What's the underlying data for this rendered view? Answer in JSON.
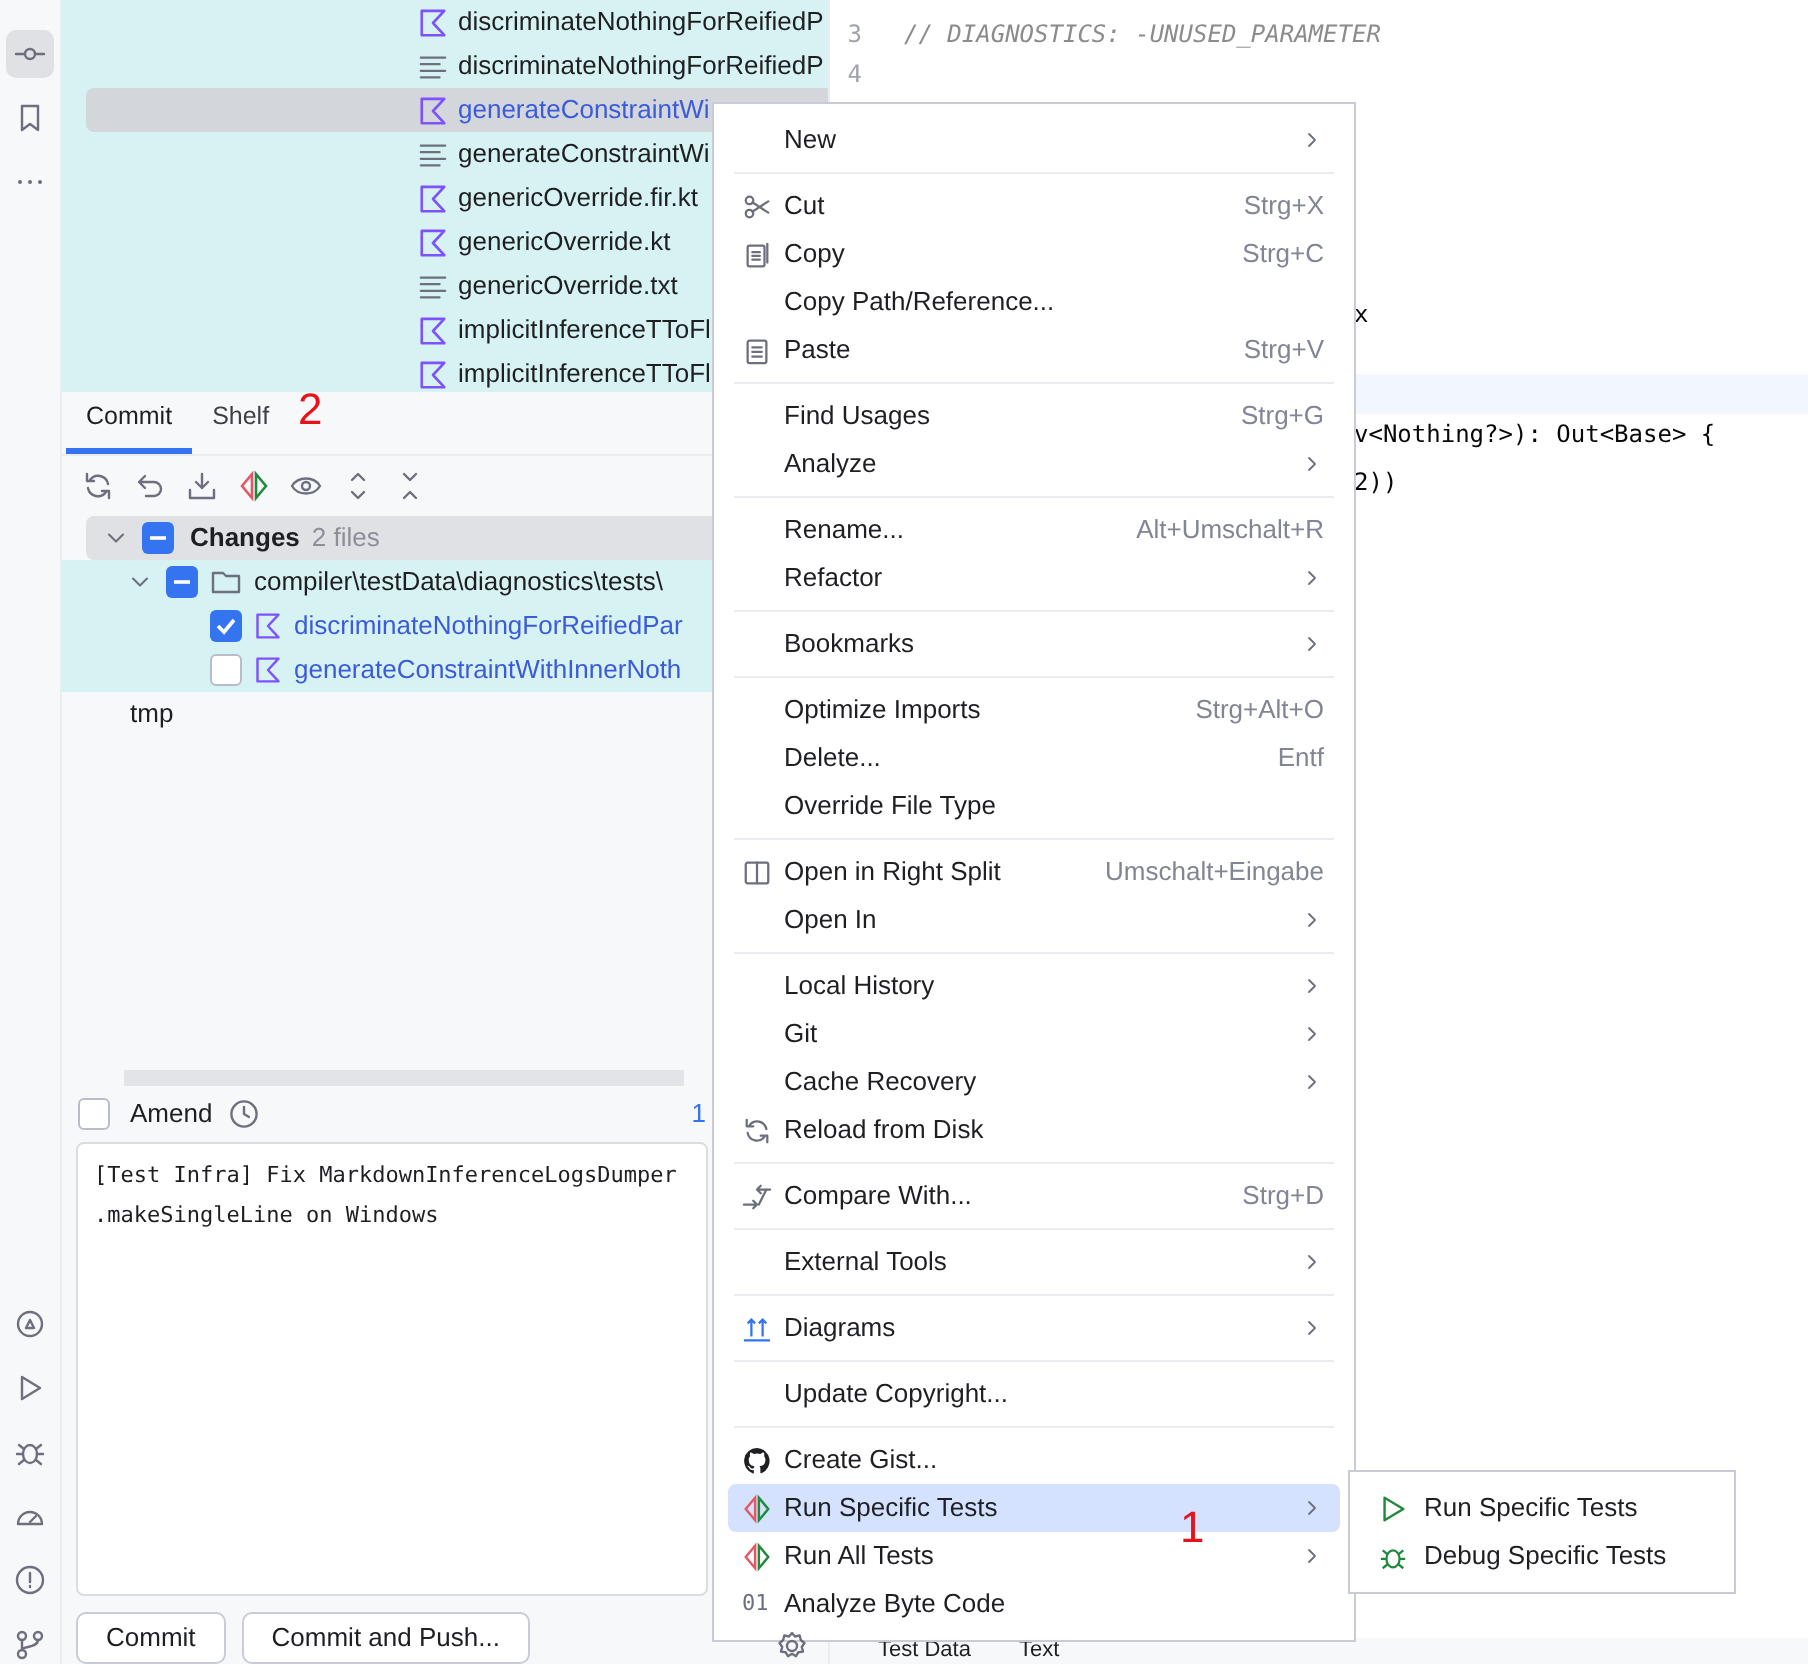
{
  "tool_strip": {
    "top": [
      {
        "selected": true
      },
      {
        "selected": false
      },
      {
        "selected": false
      }
    ]
  },
  "project_tree": {
    "rows": [
      {
        "label": "discriminateNothingForReifiedP",
        "kind": "kotlin",
        "selected": false,
        "modified": false
      },
      {
        "label": "discriminateNothingForReifiedP",
        "kind": "text",
        "selected": false,
        "modified": false
      },
      {
        "label": "generateConstraintWi",
        "kind": "kotlin",
        "selected": true,
        "modified": true
      },
      {
        "label": "generateConstraintWi",
        "kind": "text",
        "selected": false,
        "modified": false
      },
      {
        "label": "genericOverride.fir.kt",
        "kind": "kotlin",
        "selected": false,
        "modified": false
      },
      {
        "label": "genericOverride.kt",
        "kind": "kotlin",
        "selected": false,
        "modified": false
      },
      {
        "label": "genericOverride.txt",
        "kind": "text",
        "selected": false,
        "modified": false
      },
      {
        "label": "implicitInferenceTToFl",
        "kind": "kotlin",
        "selected": false,
        "modified": false
      },
      {
        "label": "implicitInferenceTToFl",
        "kind": "kotlin",
        "selected": false,
        "modified": false
      }
    ]
  },
  "commit_tabs": [
    {
      "label": "Commit",
      "selected": true
    },
    {
      "label": "Shelf",
      "selected": false
    }
  ],
  "annotations": [
    {
      "text": "2"
    },
    {
      "text": "1"
    }
  ],
  "changes": {
    "label": "Changes",
    "count": "2 files",
    "partial": true,
    "folder": {
      "path": "compiler\\testData\\diagnostics\\tests\\",
      "partial": true
    },
    "files": [
      {
        "label": "discriminateNothingForReifiedPar",
        "checked": true
      },
      {
        "label": "generateConstraintWithInnerNoth",
        "checked": false
      }
    ]
  },
  "unversioned": {
    "label": "tmp"
  },
  "amend": {
    "label": "Amend",
    "checked": false,
    "counter": "1"
  },
  "commit_message": {
    "value": "[Test Infra] Fix MarkdownInferenceLogsDumper\n.makeSingleLine on Windows"
  },
  "commit_buttons": [
    "Commit",
    "Commit and Push..."
  ],
  "editor": {
    "lines": [
      {
        "number": "3",
        "text": "// DIAGNOSTICS: -UNUSED_PARAMETER",
        "kind": "comment"
      },
      {
        "number": "4"
      }
    ],
    "fragments": [
      {
        "text": "x"
      },
      {
        "text": "v<Nothing?>): Out<Base> {"
      },
      {
        "text": "2))"
      }
    ],
    "bottom_tabs": [
      "Test Data",
      "Text"
    ]
  },
  "context_menu": {
    "items": [
      {
        "kind": "plain",
        "label": "New",
        "has_submenu": true,
        "selected": false
      },
      {
        "kind": "separator"
      },
      {
        "kind": "cut",
        "label": "Cut",
        "shortcut": "Strg+X",
        "has_submenu": false,
        "selected": false
      },
      {
        "kind": "copy",
        "label": "Copy",
        "shortcut": "Strg+C",
        "has_submenu": false,
        "selected": false
      },
      {
        "kind": "plain",
        "label": "Copy Path/Reference...",
        "has_submenu": false,
        "selected": false
      },
      {
        "kind": "paste",
        "label": "Paste",
        "shortcut": "Strg+V",
        "has_submenu": false,
        "selected": false
      },
      {
        "kind": "separator"
      },
      {
        "kind": "plain",
        "label": "Find Usages",
        "shortcut": "Strg+G",
        "has_submenu": false,
        "selected": false
      },
      {
        "kind": "plain",
        "label": "Analyze",
        "has_submenu": true,
        "selected": false
      },
      {
        "kind": "separator"
      },
      {
        "kind": "plain",
        "label": "Rename...",
        "shortcut": "Alt+Umschalt+R",
        "has_submenu": false,
        "selected": false
      },
      {
        "kind": "plain",
        "label": "Refactor",
        "has_submenu": true,
        "selected": false
      },
      {
        "kind": "separator"
      },
      {
        "kind": "plain",
        "label": "Bookmarks",
        "has_submenu": true,
        "selected": false
      },
      {
        "kind": "separator"
      },
      {
        "kind": "plain",
        "label": "Optimize Imports",
        "shortcut": "Strg+Alt+O",
        "has_submenu": false,
        "selected": false
      },
      {
        "kind": "plain",
        "label": "Delete...",
        "shortcut": "Entf",
        "has_submenu": false,
        "selected": false
      },
      {
        "kind": "plain",
        "label": "Override File Type",
        "has_submenu": false,
        "selected": false
      },
      {
        "kind": "separator"
      },
      {
        "kind": "split",
        "label": "Open in Right Split",
        "shortcut": "Umschalt+Eingabe",
        "has_submenu": false,
        "selected": false
      },
      {
        "kind": "plain",
        "label": "Open In",
        "has_submenu": true,
        "selected": false
      },
      {
        "kind": "separator"
      },
      {
        "kind": "plain",
        "label": "Local History",
        "has_submenu": true,
        "selected": false
      },
      {
        "kind": "plain",
        "label": "Git",
        "has_submenu": true,
        "selected": false
      },
      {
        "kind": "plain",
        "label": "Cache Recovery",
        "has_submenu": true,
        "selected": false
      },
      {
        "kind": "reload",
        "label": "Reload from Disk",
        "has_submenu": false,
        "selected": false
      },
      {
        "kind": "separator"
      },
      {
        "kind": "compare",
        "label": "Compare With...",
        "shortcut": "Strg+D",
        "has_submenu": false,
        "selected": false
      },
      {
        "kind": "separator"
      },
      {
        "kind": "plain",
        "label": "External Tools",
        "has_submenu": true,
        "selected": false
      },
      {
        "kind": "separator"
      },
      {
        "kind": "diagrams",
        "label": "Diagrams",
        "has_submenu": true,
        "selected": false
      },
      {
        "kind": "separator"
      },
      {
        "kind": "plain",
        "label": "Update Copyright...",
        "has_submenu": false,
        "selected": false
      },
      {
        "kind": "separator"
      },
      {
        "kind": "gist",
        "label": "Create Gist...",
        "has_submenu": false,
        "selected": false
      },
      {
        "kind": "tests",
        "label": "Run Specific Tests",
        "has_submenu": true,
        "selected": true
      },
      {
        "kind": "tests",
        "label": "Run All Tests",
        "has_submenu": true,
        "selected": false
      },
      {
        "kind": "bytecode",
        "label": "Analyze Byte Code",
        "icon_text": "01",
        "has_submenu": false,
        "selected": false
      }
    ]
  },
  "submenu": {
    "items": [
      {
        "label": "Run Specific Tests",
        "kind": "run"
      },
      {
        "label": "Debug Specific Tests",
        "kind": "debug"
      }
    ]
  }
}
